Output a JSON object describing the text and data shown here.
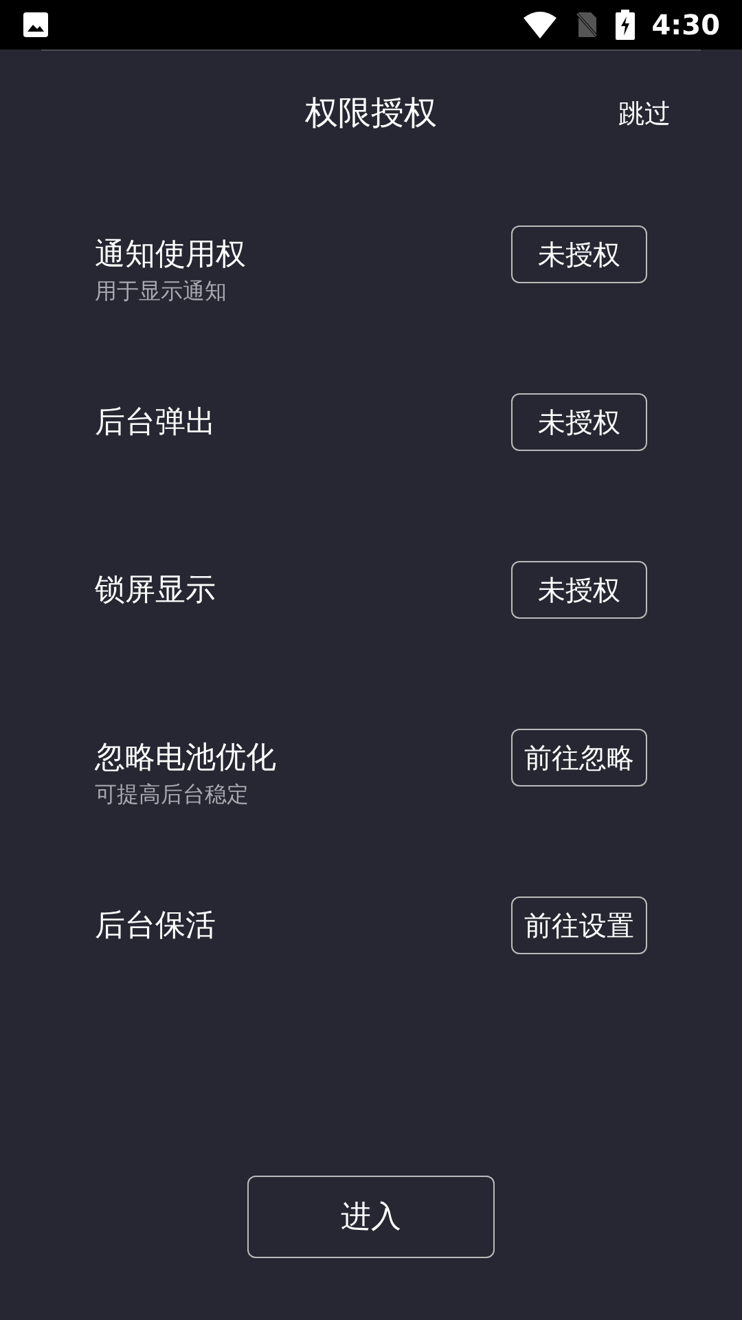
{
  "status_bar": {
    "time": "4:30"
  },
  "header": {
    "title": "权限授权",
    "skip": "跳过"
  },
  "permissions": [
    {
      "title": "通知使用权",
      "subtitle": "用于显示通知",
      "button": "未授权"
    },
    {
      "title": "后台弹出",
      "button": "未授权"
    },
    {
      "title": "锁屏显示",
      "button": "未授权"
    },
    {
      "title": "忽略电池优化",
      "subtitle": "可提高后台稳定",
      "button": "前往忽略"
    },
    {
      "title": "后台保活",
      "button": "前往设置"
    }
  ],
  "enter_button": "进入"
}
